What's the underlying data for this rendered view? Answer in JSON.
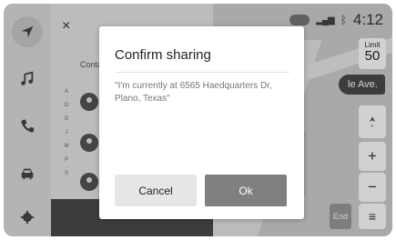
{
  "status_bar": {
    "time": "4:12",
    "signal_icon": "signal-bars-icon",
    "bluetooth_icon": "bluetooth-icon",
    "vehicle_icon": "car-status-icon"
  },
  "speed_limit": {
    "label": "Limit",
    "value": "50"
  },
  "map": {
    "street_label": "le Ave.",
    "zoom_in_label": "+",
    "zoom_out_label": "−",
    "end_label": "End",
    "menu_icon": "menu-icon",
    "compass_icon": "compass-icon"
  },
  "nav": {
    "items": [
      "navigation-icon",
      "music-icon",
      "phone-icon",
      "car-icon",
      "settings-icon"
    ]
  },
  "panel": {
    "close_label": "×",
    "contacts_label": "Conta",
    "index_letters": [
      "A",
      "·",
      "D",
      "·",
      "G",
      "·",
      "J",
      "·",
      "M",
      "·",
      "P",
      "·",
      "S"
    ]
  },
  "dialog": {
    "title": "Confirm sharing",
    "message": "\"I'm currently at 6565 Haedquarters Dr, Plano, Texas\"",
    "cancel_label": "Cancel",
    "ok_label": "Ok"
  }
}
